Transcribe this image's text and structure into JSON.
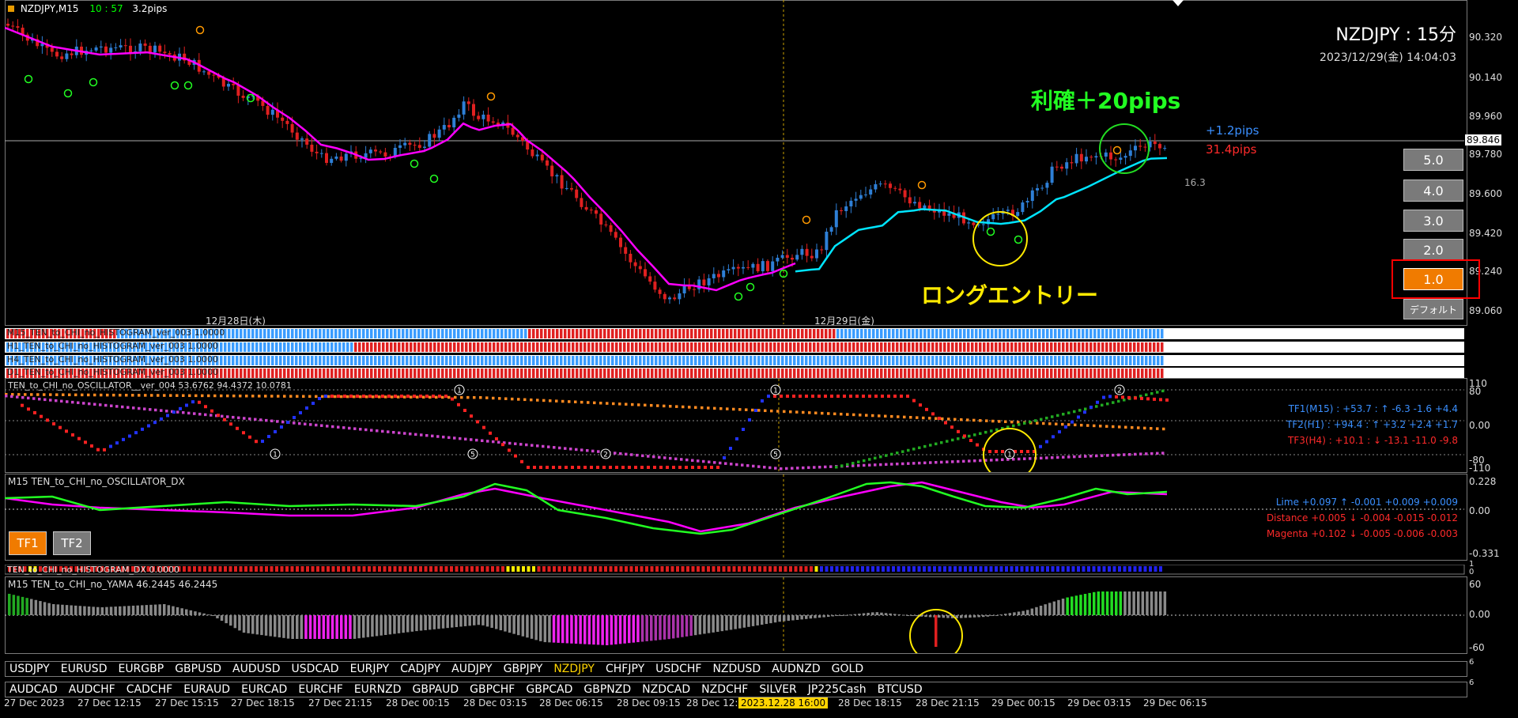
{
  "header": {
    "symbol_tf": "NZDJPY,M15",
    "countdown": "10 : 57",
    "spread": "3.2pips"
  },
  "info_panel": {
    "title": "NZDJPY : 15分",
    "datetime": "2023/12/29(金) 14:04:03",
    "pips_blue": "+1.2pips",
    "pips_red": "31.4pips",
    "small_value": "16.3"
  },
  "annotations": {
    "profit": "利確＋20pips",
    "entry": "ロングエントリー"
  },
  "price_scale": [
    "90.320",
    "90.140",
    "89.960",
    "89.846",
    "89.780",
    "89.600",
    "89.420",
    "89.240",
    "89.060"
  ],
  "current_price": "89.846",
  "lot_buttons": [
    "5.0",
    "4.0",
    "3.0",
    "2.0",
    "1.0"
  ],
  "lot_active": "1.0",
  "default_button": "デフォルト",
  "date_labels": {
    "day1": "12月28日(木)",
    "day2": "12月29日(金)"
  },
  "histograms": {
    "m15": "M15_TEN_to_CHI_no_HISTOGRAM_ver_003 1.0000",
    "h1": "H1_TEN_to_CHI_no_HISTOGRAM_ver_003 1.0000",
    "h4": "H4_TEN_to_CHI_no_HISTOGRAM_ver_003 1.0000",
    "d1": "D1_TEN_to_CHI_no_HISTOGRAM_ver_003 1.0000"
  },
  "oscillator": {
    "title": "TEN_to_CHI_no_OSCILLATOR__ver_004 53.6762 94.4372 10.0781",
    "scale": [
      "110",
      "80",
      "0.00",
      "-80",
      "-110"
    ],
    "tf1": "TF1(M15) : +53.7 : ↑ -6.3 -1.6 +4.4",
    "tf2": "TF2(H1) : +94.4 : ↑ +3.2 +2.4 +1.7",
    "tf3": "TF3(H4) : +10.1 : ↓ -13.1 -11.0 -9.8"
  },
  "dx": {
    "title": "M15 TEN_to_CHI_no_OSCILLATOR_DX",
    "scale": [
      "0.228",
      "0.00",
      "-0.331"
    ],
    "lime": "Lime +0.097 ↑ -0.001 +0.009 +0.009",
    "distance": "Distance +0.005 ↓ -0.004 -0.015 -0.012",
    "magenta": "Magenta +0.102 ↓ -0.005 -0.006 -0.003",
    "tf_buttons": [
      "TF1",
      "TF2"
    ]
  },
  "histogram_dx": {
    "title": "TEN_to_CHI_no_HISTOGRAM_DX 0.0000",
    "scale": [
      "1",
      "0"
    ]
  },
  "yama": {
    "title": "M15  TEN_to_CHI_no_YAMA  46.2445 46.2445",
    "scale": [
      "60",
      "0.00",
      "-60"
    ]
  },
  "symbols_row1": [
    "USDJPY",
    "EURUSD",
    "EURGBP",
    "GBPUSD",
    "AUDUSD",
    "USDCAD",
    "EURJPY",
    "CADJPY",
    "AUDJPY",
    "GBPJPY",
    "NZDJPY",
    "CHFJPY",
    "USDCHF",
    "NZDUSD",
    "AUDNZD",
    "GOLD"
  ],
  "symbols_row2": [
    "AUDCAD",
    "AUDCHF",
    "CADCHF",
    "EURAUD",
    "EURCAD",
    "EURCHF",
    "EURNZD",
    "GBPAUD",
    "GBPCHF",
    "GBPCAD",
    "GBPNZD",
    "NZDCAD",
    "NZDCHF",
    "SILVER",
    "JP225Cash",
    "BTCUSD"
  ],
  "active_symbol": "NZDJPY",
  "time_axis": [
    "27 Dec 2023",
    "27 Dec 12:15",
    "27 Dec 15:15",
    "27 Dec 18:15",
    "27 Dec 21:15",
    "28 Dec 00:15",
    "28 Dec 03:15",
    "28 Dec 06:15",
    "28 Dec 09:15",
    "28 Dec 12:1",
    "2023.12.28 16:00",
    "28 Dec 18:15",
    "28 Dec 21:15",
    "29 Dec 00:15",
    "29 Dec 03:15",
    "29 Dec 06:15"
  ],
  "colors": {
    "bull": "#2e7fd6",
    "bear": "#e02020",
    "magenta_ma": "#ff00ff",
    "cyan_ma": "#00e5ff",
    "lime": "#22ff22",
    "yellow_circle": "#ffea00",
    "green_circle": "#22dd22",
    "active_lot": "#f07b00"
  }
}
